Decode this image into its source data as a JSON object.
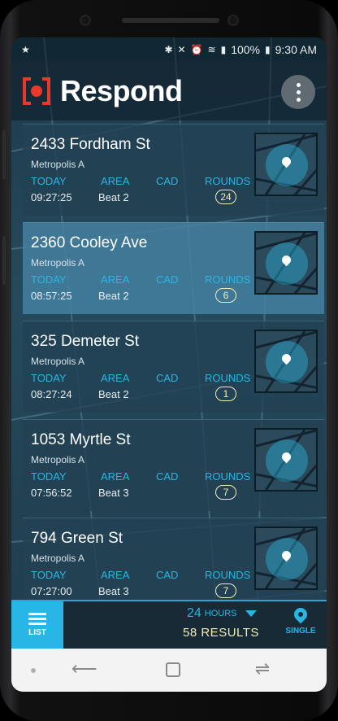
{
  "status": {
    "icons": [
      "star-icon",
      "bluetooth-icon",
      "mute-icon",
      "alarm-icon",
      "wifi-icon",
      "signal-icon",
      "battery-icon"
    ],
    "battery": "100%",
    "time": "9:30 AM"
  },
  "app": {
    "title": "Respond",
    "brand_color": "#e8392b",
    "accent_color": "#27b6e6"
  },
  "columns": {
    "date": "TODAY",
    "area": "AREA",
    "cad": "CAD",
    "rounds": "ROUNDS"
  },
  "cards": [
    {
      "address": "2433 Fordham St",
      "city": "Metropolis A",
      "time": "09:27:25",
      "area": "Beat 2",
      "cad": "",
      "rounds": "24",
      "selected": false
    },
    {
      "address": "2360 Cooley Ave",
      "city": "Metropolis A",
      "time": "08:57:25",
      "area": "Beat 2",
      "cad": "",
      "rounds": "6",
      "selected": true
    },
    {
      "address": "325 Demeter St",
      "city": "Metropolis A",
      "time": "08:27:24",
      "area": "Beat 2",
      "cad": "",
      "rounds": "1",
      "selected": false
    },
    {
      "address": "1053 Myrtle St",
      "city": "Metropolis A",
      "time": "07:56:52",
      "area": "Beat 3",
      "cad": "",
      "rounds": "7",
      "selected": false
    },
    {
      "address": "794 Green St",
      "city": "Metropolis A",
      "time": "07:27:00",
      "area": "Beat 3",
      "cad": "",
      "rounds": "7",
      "selected": false
    }
  ],
  "bottom": {
    "list_label": "LIST",
    "hours_value": "24",
    "hours_unit": "HOURS",
    "results": "58 RESULTS",
    "single_label": "SINGLE"
  },
  "nav": {
    "back_icon": "back-icon",
    "recent_icon": "recent-apps-icon",
    "home_icon": "home-icon"
  }
}
